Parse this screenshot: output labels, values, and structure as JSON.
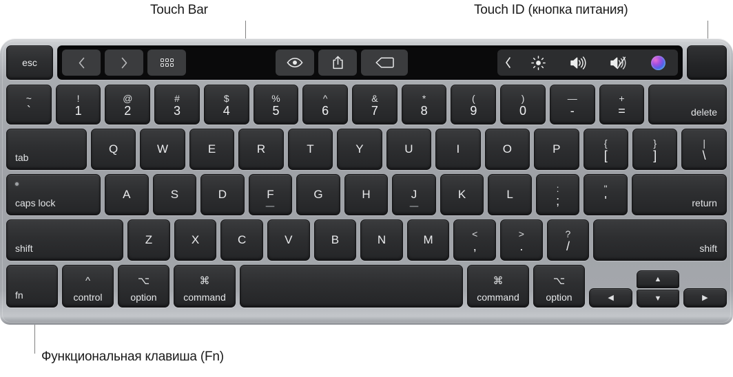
{
  "annotations": {
    "touch_bar": "Touch Bar",
    "touch_id": "Touch ID (кнопка питания)",
    "fn_key": "Функциональная клавиша (Fn)"
  },
  "colors": {
    "key_face": "#2e2f31",
    "chassis": "#a9acb1",
    "touchbar_bg": "#0a0a0b",
    "legend": "#e9eaec"
  },
  "touch_bar": {
    "items": [
      {
        "name": "back-icon",
        "label": "‹"
      },
      {
        "name": "forward-icon",
        "label": "›"
      },
      {
        "name": "grid-view-icon",
        "label": ""
      },
      {
        "name": "preview-eye-icon",
        "label": ""
      },
      {
        "name": "share-icon",
        "label": ""
      },
      {
        "name": "tag-icon",
        "label": ""
      },
      {
        "name": "collapse-chevron-icon",
        "label": "‹"
      },
      {
        "name": "brightness-icon",
        "label": ""
      },
      {
        "name": "volume-up-icon",
        "label": ""
      },
      {
        "name": "mute-icon",
        "label": ""
      },
      {
        "name": "siri-icon",
        "label": ""
      }
    ]
  },
  "keys": {
    "esc": "esc",
    "touch_id": "",
    "row_numbers": [
      {
        "top": "~",
        "bot": "`"
      },
      {
        "top": "!",
        "bot": "1"
      },
      {
        "top": "@",
        "bot": "2"
      },
      {
        "top": "#",
        "bot": "3"
      },
      {
        "top": "$",
        "bot": "4"
      },
      {
        "top": "%",
        "bot": "5"
      },
      {
        "top": "^",
        "bot": "6"
      },
      {
        "top": "&",
        "bot": "7"
      },
      {
        "top": "*",
        "bot": "8"
      },
      {
        "top": "(",
        "bot": "9"
      },
      {
        "top": ")",
        "bot": "0"
      },
      {
        "top": "—",
        "bot": "-"
      },
      {
        "top": "+",
        "bot": "="
      }
    ],
    "delete": "delete",
    "tab": "tab",
    "row_qwerty": [
      "Q",
      "W",
      "E",
      "R",
      "T",
      "Y",
      "U",
      "I",
      "O",
      "P"
    ],
    "bracket_left": {
      "top": "{",
      "bot": "["
    },
    "bracket_right": {
      "top": "}",
      "bot": "]"
    },
    "backslash": {
      "top": "|",
      "bot": "\\"
    },
    "caps_lock": "caps lock",
    "row_home": [
      "A",
      "S",
      "D",
      "F",
      "G",
      "H",
      "J",
      "K",
      "L"
    ],
    "semicolon": {
      "top": ":",
      "bot": ";"
    },
    "quote": {
      "top": "\"",
      "bot": "'"
    },
    "return": "return",
    "shift_left": "shift",
    "row_shift": [
      "Z",
      "X",
      "C",
      "V",
      "B",
      "N",
      "M"
    ],
    "comma": {
      "top": "<",
      "bot": ","
    },
    "period": {
      "top": ">",
      "bot": "."
    },
    "slash": {
      "top": "?",
      "bot": "/"
    },
    "shift_right": "shift",
    "fn": "fn",
    "control": {
      "glyph": "^",
      "label": "control"
    },
    "option_left": {
      "glyph": "⌥",
      "label": "option"
    },
    "command_left": {
      "glyph": "⌘",
      "label": "command"
    },
    "space": "",
    "command_right": {
      "glyph": "⌘",
      "label": "command"
    },
    "option_right": {
      "glyph": "⌥",
      "label": "option"
    },
    "arrow_left": "◀",
    "arrow_up": "▲",
    "arrow_down": "▼",
    "arrow_right": "▶"
  }
}
